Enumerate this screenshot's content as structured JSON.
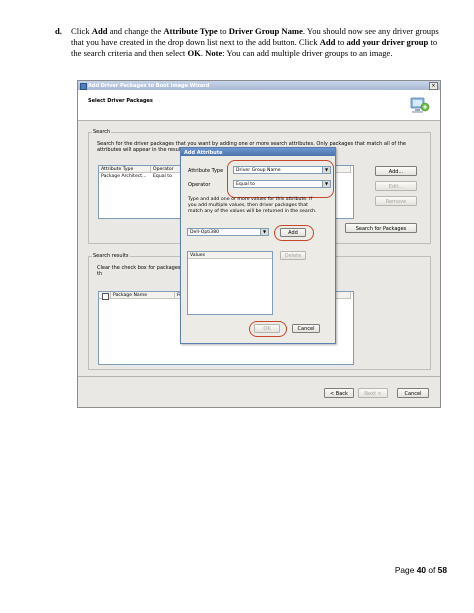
{
  "instruction": {
    "step": "d.",
    "p1": "Click ",
    "add": "Add",
    "p2": " and change the ",
    "attribute_type": "Attribute Type",
    "p3": " to ",
    "driver_group_name": "Driver Group Name",
    "p4": ". You should now see any driver groups that you have created in the drop down list next to the add button. Click ",
    "add2": "Add",
    "p5": " to ",
    "add_your_driver_group": "add your driver group",
    "p6": " to the search criteria and then select ",
    "ok": "OK",
    "p7": ". ",
    "note": "Note",
    "p8": ": You can add multiple driver groups to an image."
  },
  "wizard": {
    "title": "Add Driver Packages to Boot Image Wizard",
    "close_glyph": "×",
    "page_title": "Select Driver Packages",
    "search_group_label": "Search",
    "search_desc": "Search for the driver packages that you want by adding one or more search attributes. Only packages that match all of the attributes will appear in the results.",
    "criteria_headers": [
      "Attribute Type",
      "Operator"
    ],
    "criteria_rows": [
      [
        "Package Architect...",
        "Equal to"
      ]
    ],
    "add_button": "Add...",
    "edit_button": "Edit...",
    "remove_button": "Remove",
    "search_button": "Search for Packages",
    "results_group_label": "Search results",
    "results_desc": "Clear the check box for packages th",
    "results_headers": [
      "Package Name",
      "Fi"
    ],
    "back_button": "< Back",
    "next_button": "Next >",
    "cancel_button": "Cancel"
  },
  "dialog": {
    "title": "Add Attribute",
    "attribute_type_label": "Attribute Type",
    "attribute_type_value": "Driver Group Name",
    "operator_label": "Operator",
    "operator_value": "Equal to",
    "info": "Type and add one or more values for this attribute. If you add multiple values, then driver packages that match any of the values will be returned in the search.",
    "value_input": "Dell-Opti380",
    "add_button": "Add",
    "values_header": "Values",
    "delete_button": "Delete",
    "ok_button": "OK",
    "cancel_button": "Cancel"
  },
  "page": {
    "prefix": "Page ",
    "current": "40",
    "of": " of ",
    "total": "58"
  },
  "colors": {
    "highlight_ring": "#c8462a",
    "dialog_title": "#4b74ad"
  }
}
